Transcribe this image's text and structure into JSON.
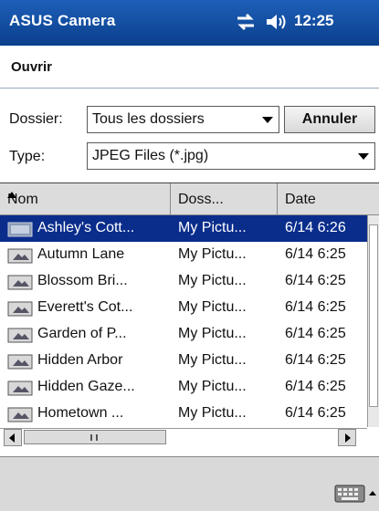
{
  "titlebar": {
    "app_name": "ASUS Camera",
    "time": "12:25",
    "connectivity_icon": "connectivity-icon",
    "volume_icon": "speaker-icon"
  },
  "dialog": {
    "title": "Ouvrir"
  },
  "form": {
    "folder_label": "Dossier:",
    "folder_value": "Tous les dossiers",
    "cancel_label": "Annuler",
    "type_label": "Type:",
    "type_value": "JPEG Files (*.jpg)"
  },
  "columns": [
    {
      "label": "Nom",
      "sorted": "ascending"
    },
    {
      "label": "Doss..."
    },
    {
      "label": "Date"
    }
  ],
  "files": [
    {
      "name": "Ashley's Cott...",
      "folder": "My Pictu...",
      "date": "6/14 6:26",
      "selected": true
    },
    {
      "name": "Autumn Lane",
      "folder": "My Pictu...",
      "date": "6/14 6:25"
    },
    {
      "name": "Blossom Bri...",
      "folder": "My Pictu...",
      "date": "6/14 6:25"
    },
    {
      "name": "Everett's Cot...",
      "folder": "My Pictu...",
      "date": "6/14 6:25"
    },
    {
      "name": "Garden of P...",
      "folder": "My Pictu...",
      "date": "6/14 6:25"
    },
    {
      "name": "Hidden Arbor",
      "folder": "My Pictu...",
      "date": "6/14 6:25"
    },
    {
      "name": "Hidden Gaze...",
      "folder": "My Pictu...",
      "date": "6/14 6:25"
    },
    {
      "name": "Hometown ...",
      "folder": "My Pictu...",
      "date": "6/14 6:25"
    }
  ],
  "colors": {
    "titlebar": "#0b3f8c",
    "selection": "#0a2d8c"
  },
  "icons": {
    "file": "image-file-icon",
    "keyboard": "keyboard-icon"
  }
}
